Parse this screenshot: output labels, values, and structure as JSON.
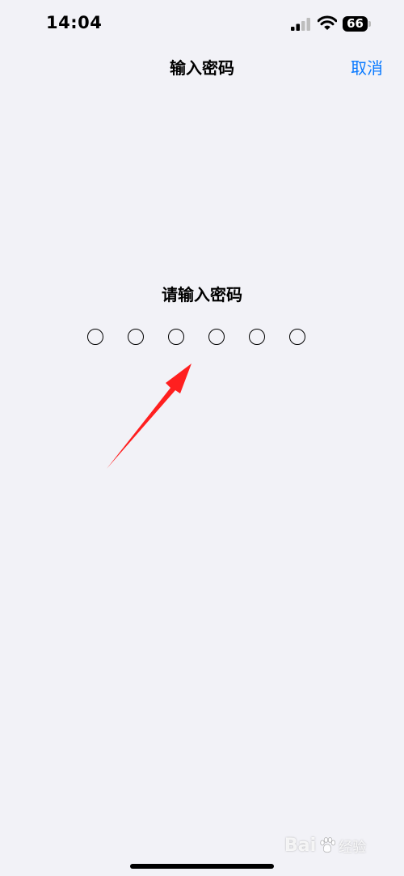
{
  "status_bar": {
    "time": "14:04",
    "battery_level": "66",
    "signal_icon": "cellular-signal-icon",
    "wifi_icon": "wifi-icon",
    "battery_icon": "battery-icon"
  },
  "nav": {
    "title": "输入密码",
    "cancel_label": "取消"
  },
  "passcode": {
    "prompt": "请输入密码",
    "digit_count": 6,
    "filled": 0
  },
  "annotation": {
    "type": "red-arrow",
    "color": "#FF1F1F"
  },
  "watermark": {
    "brand": "Bai",
    "paw_icon": "paw-icon",
    "suffix": "经验"
  },
  "colors": {
    "background": "#F2F2F7",
    "accent": "#0A7AFF",
    "text": "#000000"
  }
}
